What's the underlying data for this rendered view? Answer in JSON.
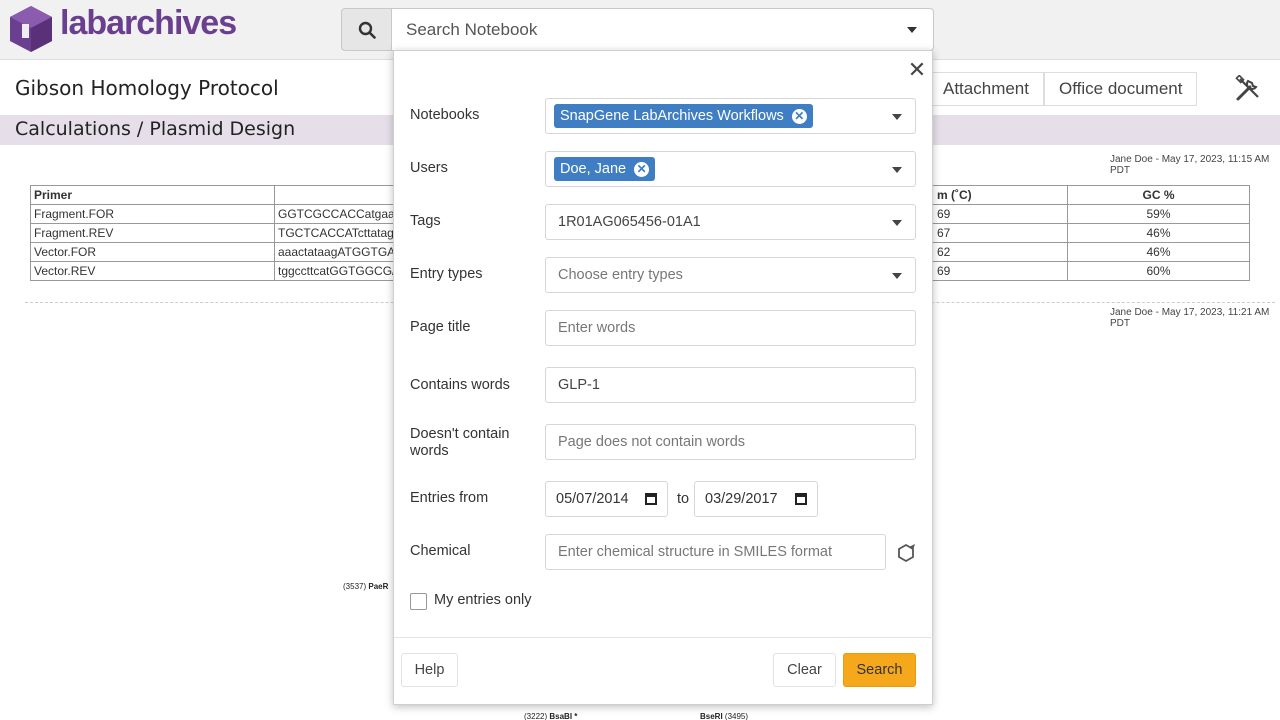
{
  "app": {
    "logo_text": "labarchives",
    "brand_color": "#6a3f8f",
    "accent_color": "#f6a81c",
    "chip_color": "#3f7ec3"
  },
  "header": {
    "search_icon": "search-icon",
    "search_placeholder": "Search Notebook"
  },
  "page": {
    "title": "Gibson Homology Protocol",
    "section": "Calculations / Plasmid Design",
    "tabs": [
      {
        "label": "Attachment"
      },
      {
        "label": "Office document"
      }
    ],
    "stamp1": "Jane Doe - May 17, 2023, 11:15 AM PDT",
    "stamp2": "Jane Doe - May 17, 2023, 11:21 AM PDT",
    "table": {
      "headers": [
        "Primer",
        "",
        "m (˚C)",
        "GC %"
      ],
      "rows": [
        {
          "name": "Fragment.FOR",
          "seq": "GGTCGCCACCatgaa",
          "tm": "69",
          "gc": "59%"
        },
        {
          "name": "Fragment.REV",
          "seq": "TGCTCACCATcttatag",
          "tm": "67",
          "gc": "46%"
        },
        {
          "name": "Vector.FOR",
          "seq": "aaactataagATGGTGA",
          "tm": "62",
          "gc": "46%"
        },
        {
          "name": "Vector.REV",
          "seq": "tggccttcatGGTGGCG/",
          "tm": "69",
          "gc": "60%"
        }
      ]
    },
    "map_labels": {
      "a_num": "(3537)",
      "a_name": "PaeR",
      "b_num": "(3222)",
      "b_name": "BsaBI *",
      "c_name": "BseRI",
      "c_num": "(3495)"
    }
  },
  "modal": {
    "close_icon": "close-icon",
    "notebooks": {
      "label": "Notebooks",
      "chip": "SnapGene LabArchives Workflows"
    },
    "users": {
      "label": "Users",
      "chip": "Doe, Jane"
    },
    "tags": {
      "label": "Tags",
      "value": "1R01AG065456-01A1"
    },
    "entry_types": {
      "label": "Entry types",
      "placeholder": "Choose entry types"
    },
    "page_title": {
      "label": "Page title",
      "placeholder": "Enter words"
    },
    "contains": {
      "label": "Contains words",
      "value": "GLP-1"
    },
    "not_contains": {
      "label_line1": "Doesn't contain",
      "label_line2": "words",
      "placeholder": "Page does not contain words"
    },
    "entries_from": {
      "label": "Entries from",
      "from": "05/07/2014",
      "to_label": "to",
      "to": "03/29/2017"
    },
    "chemical": {
      "label": "Chemical",
      "placeholder": "Enter chemical structure in SMILES format",
      "icon": "structure-editor-icon"
    },
    "my_entries": {
      "label": "My entries only",
      "checked": false
    },
    "buttons": {
      "help": "Help",
      "clear": "Clear",
      "search": "Search"
    }
  }
}
